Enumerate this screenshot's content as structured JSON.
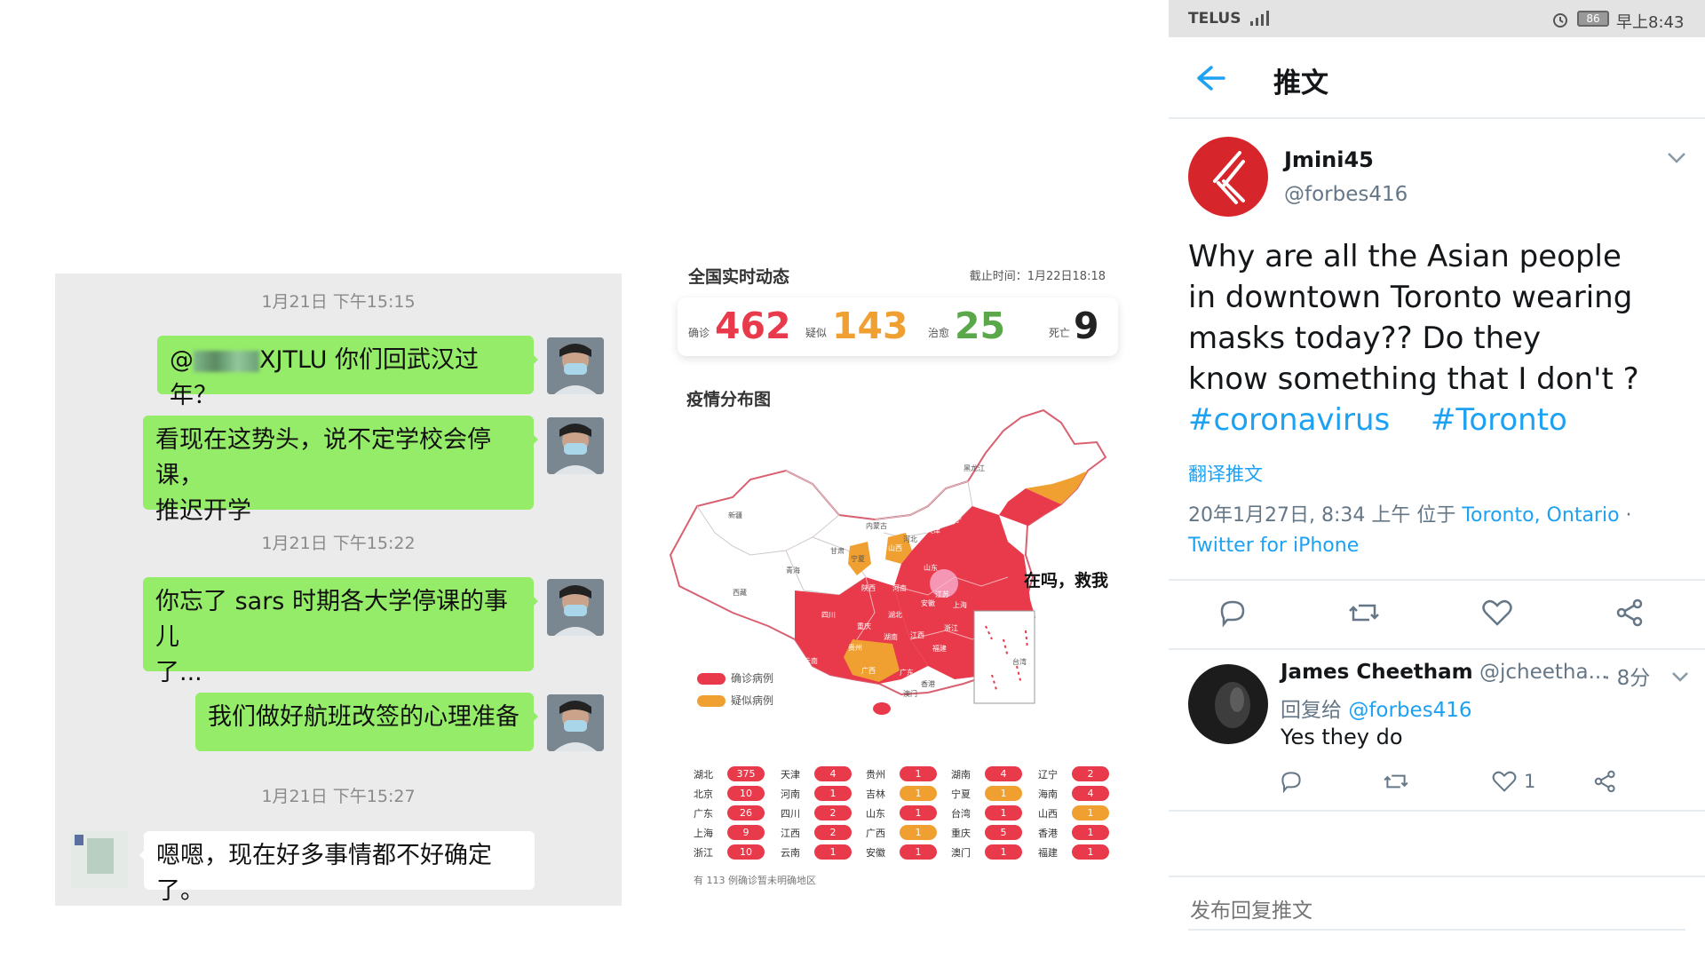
{
  "chat": {
    "timestamps": [
      "1月21日 下午15:15",
      "1月21日 下午15:22",
      "1月21日 下午15:27"
    ],
    "messages": [
      {
        "prefix": "@",
        "text": "XJTLU 你们回武汉过年？"
      },
      {
        "line1": "看现在这势头，说不定学校会停课，",
        "line2": "推迟开学"
      },
      {
        "line1": "你忘了 sars 时期各大学停课的事儿",
        "line2": "了..."
      },
      {
        "text": "我们做好航班改签的心理准备"
      },
      {
        "text": "嗯嗯，现在好多事情都不好确定了。"
      }
    ]
  },
  "epidemic": {
    "title": "全国实时动态",
    "time": "截止时间：1月22日18:18",
    "stats": [
      {
        "label": "确诊",
        "value": "462",
        "color": "#e83a4a"
      },
      {
        "label": "疑似",
        "value": "143",
        "color": "#f0a030"
      },
      {
        "label": "治愈",
        "value": "25",
        "color": "#5aa84a"
      },
      {
        "label": "死亡",
        "value": "9",
        "color": "#222222"
      }
    ],
    "map_title": "疫情分布图",
    "map_regions": [
      "黑龙江",
      "吉林",
      "辽宁",
      "内蒙古",
      "北京",
      "天津",
      "河北",
      "山西",
      "宁夏",
      "甘肃",
      "新疆",
      "西藏",
      "青海",
      "陕西",
      "河南",
      "山东",
      "江苏",
      "安徽",
      "上海",
      "湖北",
      "四川",
      "重庆",
      "湖南",
      "江西",
      "浙江",
      "福建",
      "贵州",
      "云南",
      "广西",
      "广东",
      "香港",
      "澳门",
      "台湾"
    ],
    "bubble_text": "在吗，救我",
    "legend": [
      {
        "label": "确诊病例",
        "color": "#e83a4a"
      },
      {
        "label": "疑似病例",
        "color": "#f0a030"
      }
    ],
    "province_table": [
      [
        {
          "name": "湖北",
          "value": "375",
          "kind": "c"
        },
        {
          "name": "天津",
          "value": "4",
          "kind": "c"
        },
        {
          "name": "贵州",
          "value": "1",
          "kind": "c"
        },
        {
          "name": "湖南",
          "value": "4",
          "kind": "c"
        },
        {
          "name": "辽宁",
          "value": "2",
          "kind": "c"
        }
      ],
      [
        {
          "name": "北京",
          "value": "10",
          "kind": "c"
        },
        {
          "name": "河南",
          "value": "1",
          "kind": "c"
        },
        {
          "name": "吉林",
          "value": "1",
          "kind": "s"
        },
        {
          "name": "宁夏",
          "value": "1",
          "kind": "s"
        },
        {
          "name": "海南",
          "value": "4",
          "kind": "c"
        }
      ],
      [
        {
          "name": "广东",
          "value": "26",
          "kind": "c"
        },
        {
          "name": "四川",
          "value": "2",
          "kind": "c"
        },
        {
          "name": "山东",
          "value": "1",
          "kind": "c"
        },
        {
          "name": "台湾",
          "value": "1",
          "kind": "c"
        },
        {
          "name": "山西",
          "value": "1",
          "kind": "s"
        }
      ],
      [
        {
          "name": "上海",
          "value": "9",
          "kind": "c"
        },
        {
          "name": "江西",
          "value": "2",
          "kind": "c"
        },
        {
          "name": "广西",
          "value": "1",
          "kind": "s"
        },
        {
          "name": "重庆",
          "value": "5",
          "kind": "c"
        },
        {
          "name": "香港",
          "value": "1",
          "kind": "c"
        }
      ],
      [
        {
          "name": "浙江",
          "value": "10",
          "kind": "c"
        },
        {
          "name": "云南",
          "value": "1",
          "kind": "c"
        },
        {
          "name": "安徽",
          "value": "1",
          "kind": "c"
        },
        {
          "name": "澳门",
          "value": "1",
          "kind": "c"
        },
        {
          "name": "福建",
          "value": "1",
          "kind": "c"
        }
      ]
    ],
    "footnote": "有 113 例确诊暂未明确地区"
  },
  "twitter": {
    "status_carrier": "TELUS",
    "status_battery": "86",
    "status_time": "早上8:43",
    "page_title": "推文",
    "author_name": "Jmini45",
    "author_handle": "@forbes416",
    "tweet_lines": [
      "Why are all the Asian people",
      "in downtown Toronto wearing",
      "masks today??  Do they",
      "know something that I don't ?"
    ],
    "hashtags": [
      "#coronavirus",
      "#Toronto"
    ],
    "translate": "翻译推文",
    "meta_prefix": "20年1月27日, 8:34 上午 位于 ",
    "meta_location": "Toronto, Ontario",
    "meta_sep": " ·",
    "meta_client": "Twitter for iPhone",
    "reply": {
      "name": "James Cheetham",
      "handle": "@jcheetha...",
      "time": "· 8分",
      "replying_label": "回复给 ",
      "replying_to": "@forbes416",
      "text": "Yes they do",
      "like_count": "1"
    },
    "compose_placeholder": "发布回复推文",
    "colors": {
      "link": "#1da1f2",
      "avatar_red": "#d7262b"
    }
  }
}
